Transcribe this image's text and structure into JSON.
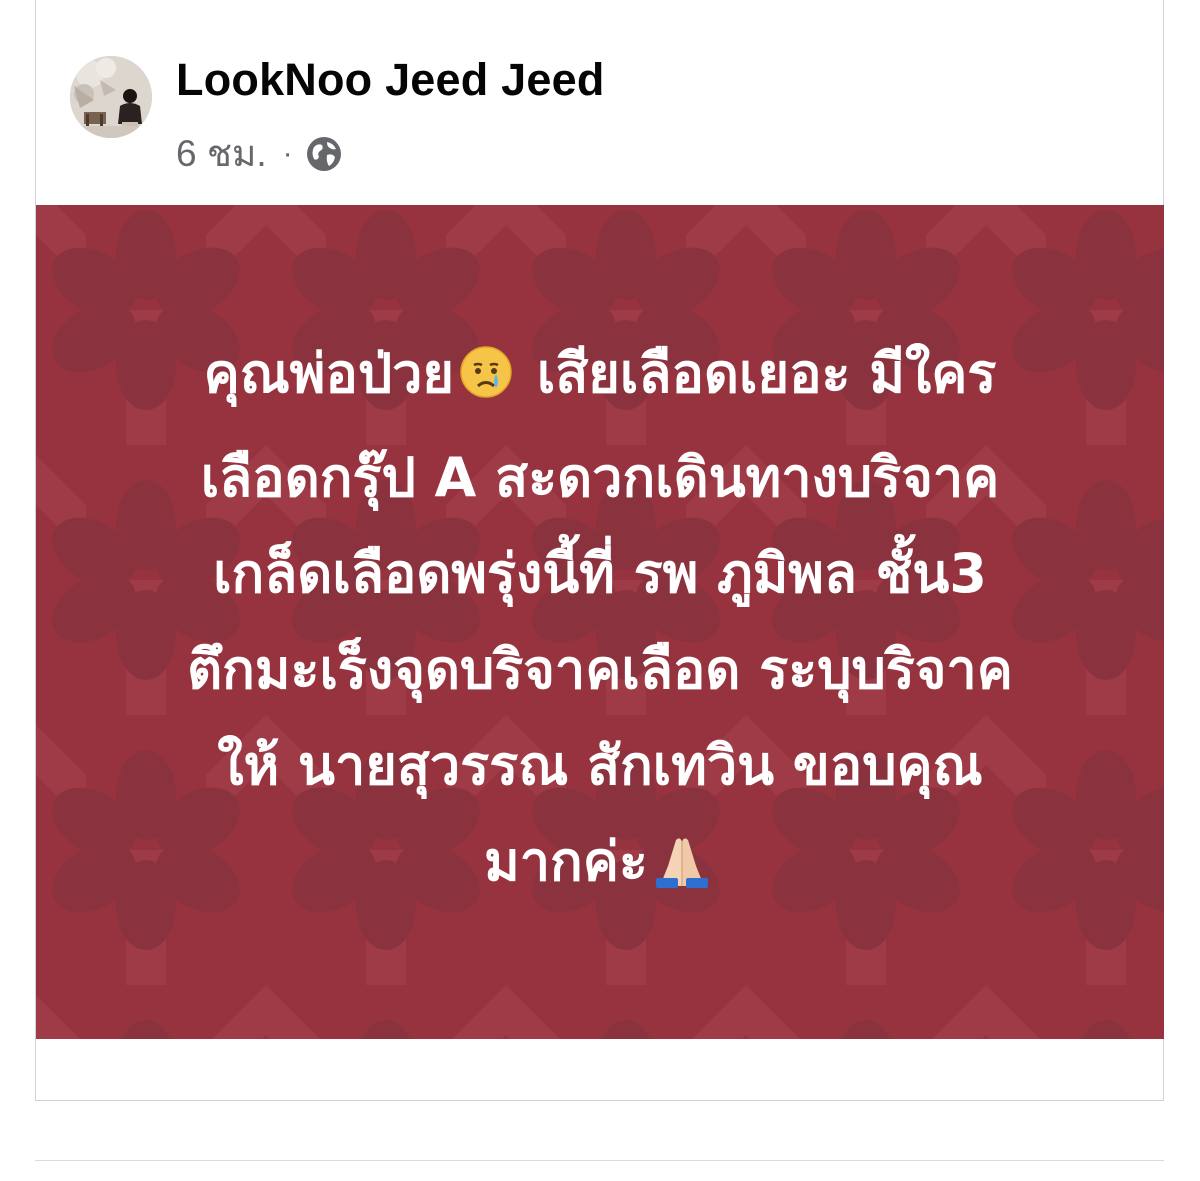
{
  "post": {
    "author_name": "LookNoo Jeed Jeed",
    "timestamp": "6 ชม.",
    "separator": "·",
    "privacy_icon": "globe-icon",
    "avatar_icon": "avatar-photo",
    "background_color": "#993540",
    "text_color": "#ffffff",
    "lines": [
      {
        "text": "คุณพ่อป่วย",
        "emoji": "crying-face-emoji",
        "text_after": " เสียเลือดเยอะ มีใคร"
      },
      {
        "text": "เลือดกรุ๊ป A สะดวกเดินทางบริจาค"
      },
      {
        "text": "เกล็ดเลือดพรุ่งนี้ที่ รพ ภูมิพล ชั้น3"
      },
      {
        "text": "ตึกมะเร็งจุดบริจาคเลือด ระบุบริจาค"
      },
      {
        "text": "ให้ นายสุวรรณ สักเทวิน ขอบคุณ"
      },
      {
        "text": "มากค่ะ",
        "emoji": "folded-hands-emoji"
      }
    ]
  }
}
